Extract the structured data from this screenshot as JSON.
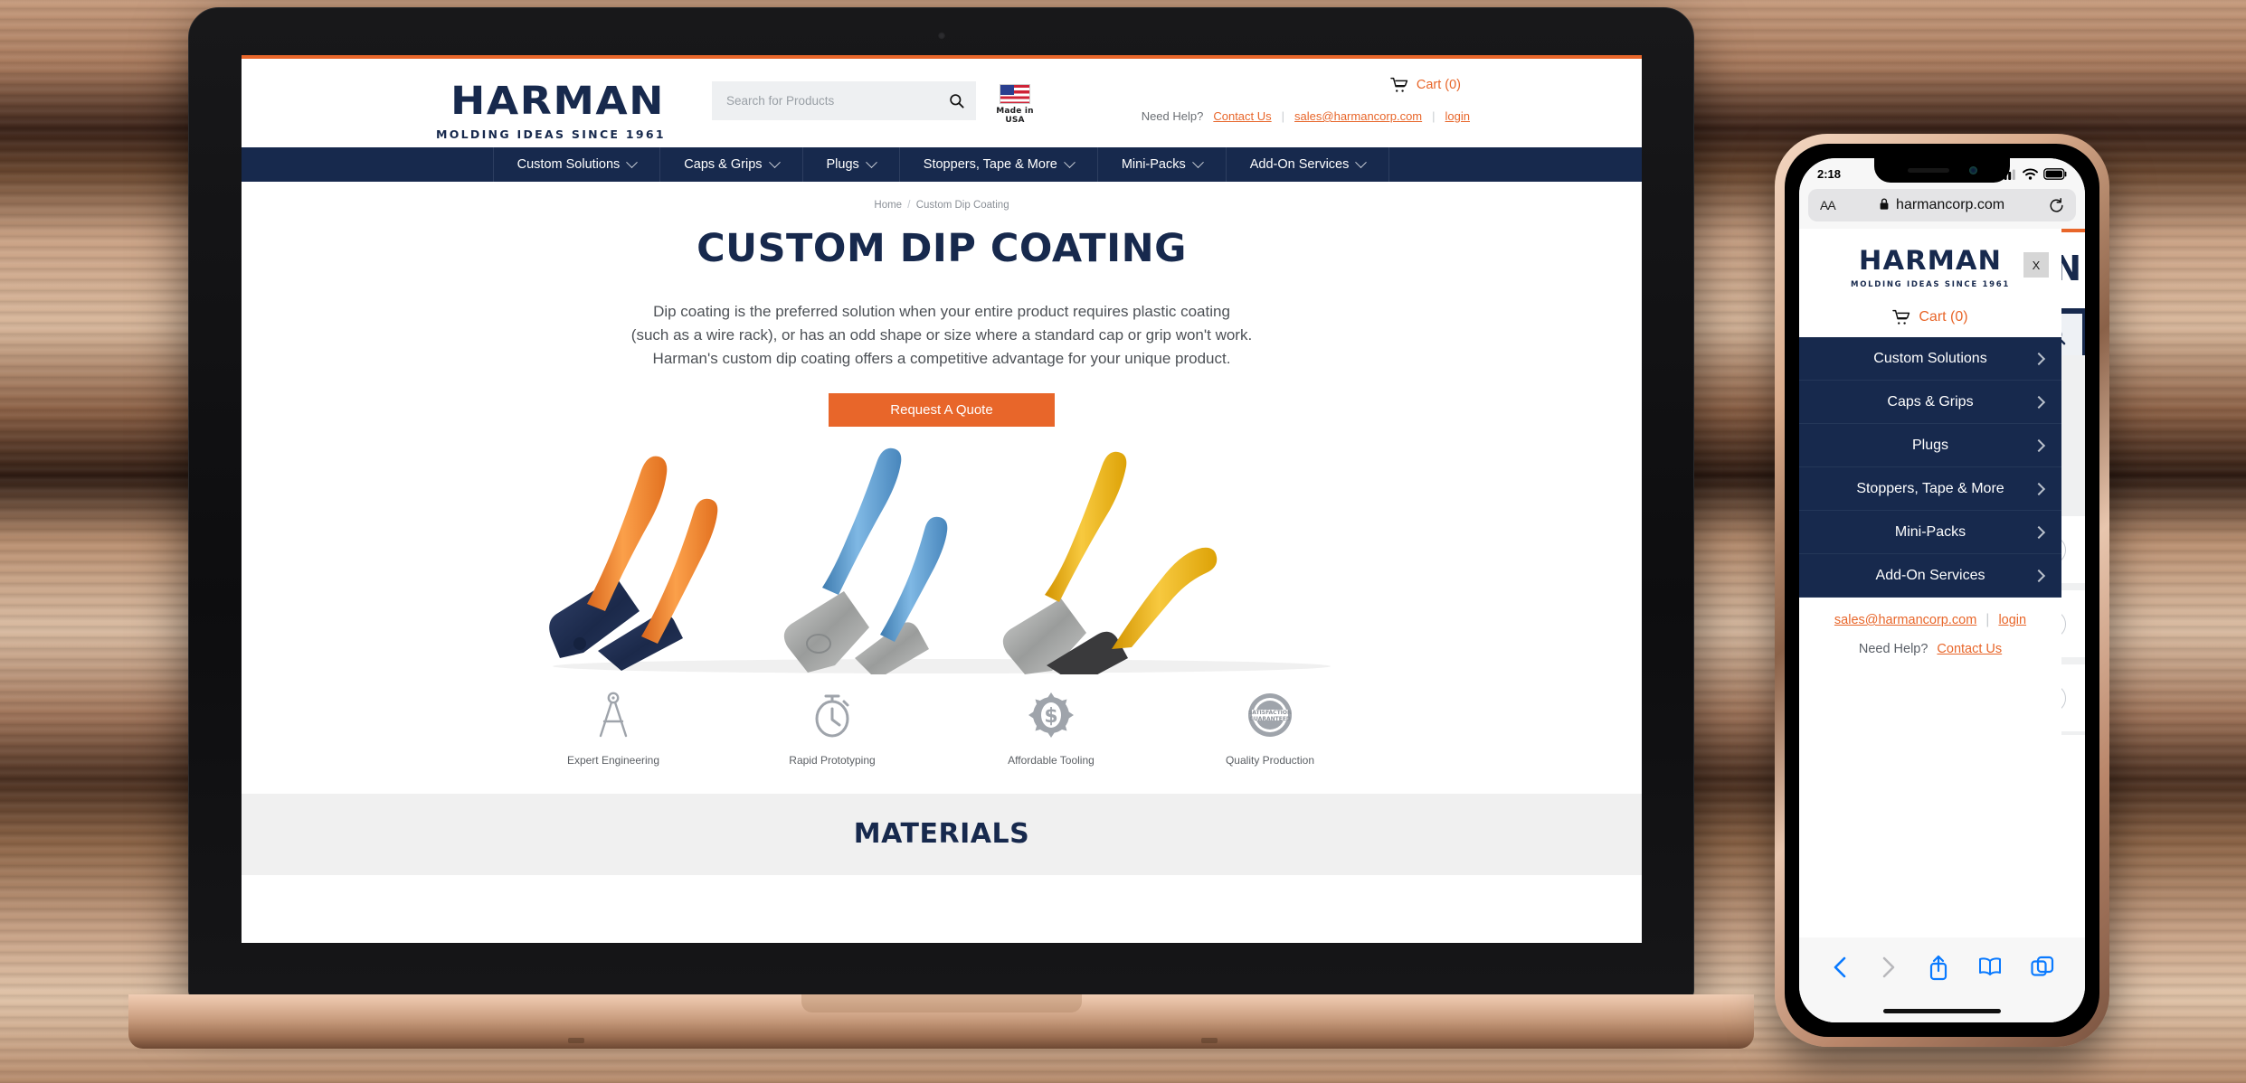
{
  "colors": {
    "navy": "#17294d",
    "orange": "#e8662a",
    "gray_band": "#f0f0f0",
    "search_bg": "#eef0f2"
  },
  "site": {
    "logo": {
      "word": "HARMAN",
      "tagline": "MOLDING IDEAS SINCE 1961"
    },
    "search": {
      "placeholder": "Search for Products",
      "value": ""
    },
    "made_in_usa": "Made in USA",
    "cart": "Cart (0)",
    "help": {
      "need_help": "Need Help?",
      "contact_us": "Contact Us",
      "email": "sales@harmancorp.com",
      "login": "login"
    },
    "nav": [
      {
        "label": "Custom Solutions"
      },
      {
        "label": "Caps & Grips"
      },
      {
        "label": "Plugs"
      },
      {
        "label": "Stoppers, Tape & More"
      },
      {
        "label": "Mini-Packs"
      },
      {
        "label": "Add-On Services"
      }
    ],
    "breadcrumb": {
      "home": "Home",
      "separator": "/",
      "current": "Custom Dip Coating"
    },
    "page_title": "CUSTOM DIP COATING",
    "intro_lines": [
      "Dip coating is the preferred solution when your entire product requires plastic coating",
      "(such as a wire rack), or has an odd shape or size where a standard cap or grip won't work.",
      "Harman's custom dip coating offers a competitive advantage for your unique product."
    ],
    "cta": "Request A Quote",
    "features": [
      {
        "icon": "compass-icon",
        "label": "Expert Engineering"
      },
      {
        "icon": "stopwatch-icon",
        "label": "Rapid Prototyping"
      },
      {
        "icon": "gear-dollar-icon",
        "label": "Affordable Tooling"
      },
      {
        "icon": "satisfaction-badge-icon",
        "label": "Quality Production"
      }
    ],
    "badge_text": {
      "line1": "SATISFACTION",
      "line2": "GUARANTEED"
    },
    "materials_heading": "MATERIALS",
    "hero_alt_colors": {
      "orange": "#f08a2e",
      "blue": "#5c9ed6",
      "yellow": "#edb018"
    }
  },
  "phone": {
    "status": {
      "time": "2:18"
    },
    "browser": {
      "aa": "AA",
      "lock": "ὑ2",
      "url": "harmancorp.com"
    },
    "drawer": {
      "logo_word": "HARMAN",
      "logo_tagline": "MOLDING IDEAS SINCE 1961",
      "close": "X",
      "cart": "Cart (0)",
      "items": [
        {
          "label": "Custom Solutions"
        },
        {
          "label": "Caps & Grips"
        },
        {
          "label": "Plugs"
        },
        {
          "label": "Stoppers, Tape & More"
        },
        {
          "label": "Mini-Packs"
        },
        {
          "label": "Add-On Services"
        }
      ],
      "email": "sales@harmancorp.com",
      "login": "login",
      "need_help": "Need Help?",
      "contact_us": "Contact Us"
    },
    "behind": {
      "logo_fragment": "N"
    }
  }
}
